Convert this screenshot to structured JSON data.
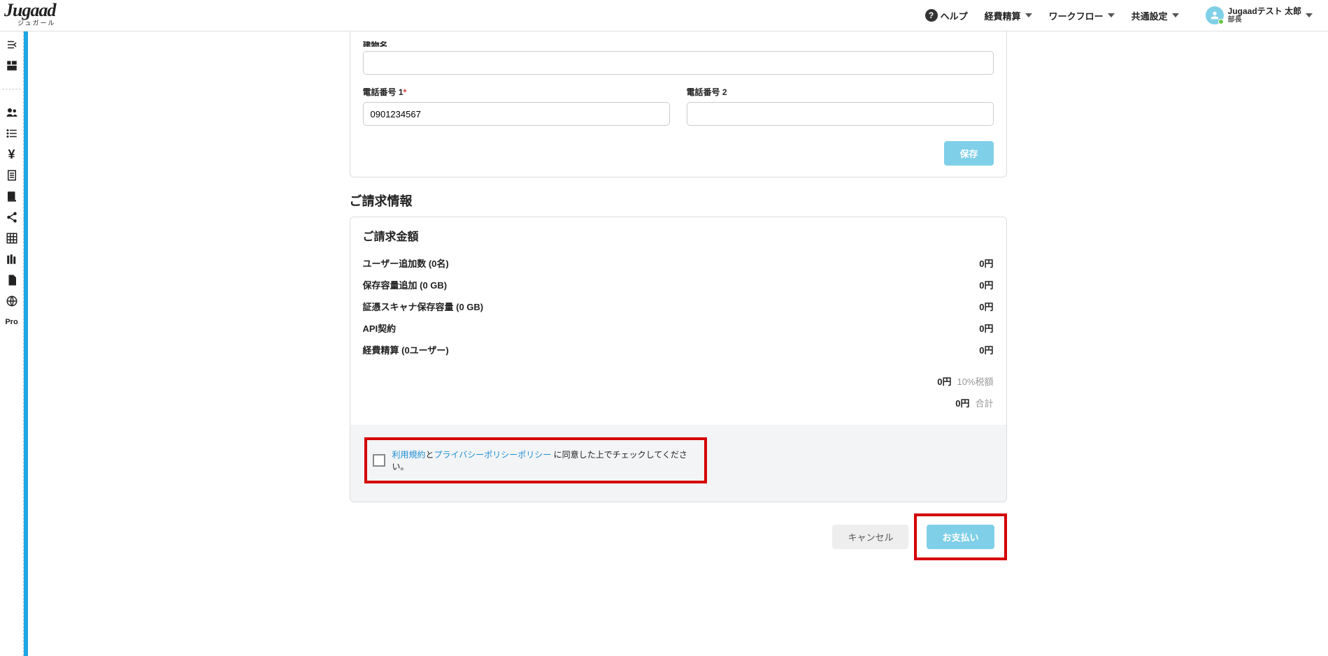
{
  "header": {
    "logo": "Jugaad",
    "logo_sub": "ジュガール",
    "help": "ヘルプ",
    "nav": {
      "expense": "経費精算",
      "workflow": "ワークフロー",
      "common": "共通設定"
    },
    "user": {
      "name": "Jugaadテスト 太郎",
      "role": "部長"
    }
  },
  "sidebar": {
    "pro": "Pro"
  },
  "form": {
    "building_label_cut": "建物名",
    "phone1_label": "電話番号 1",
    "phone1_value": "0901234567",
    "phone2_label": "電話番号 2",
    "phone2_value": "",
    "save": "保存"
  },
  "billing": {
    "section_title": "ご請求情報",
    "amount_title": "ご請求金額",
    "rows": [
      {
        "label": "ユーザー追加数 (0名)",
        "value": "0円"
      },
      {
        "label": "保存容量追加 (0 GB)",
        "value": "0円"
      },
      {
        "label": "証憑スキャナ保存容量 (0 GB)",
        "value": "0円"
      },
      {
        "label": "API契約",
        "value": "0円"
      },
      {
        "label": "経費精算 (0ユーザー)",
        "value": "0円"
      }
    ],
    "tax": {
      "value": "0円",
      "note": "10%税額"
    },
    "total": {
      "value": "0円",
      "note": "合計"
    }
  },
  "agree": {
    "terms": "利用規約",
    "and": "と",
    "privacy": "プライバシーポリシーポリシー",
    "rest": " に同意した上でチェックしてください。"
  },
  "actions": {
    "cancel": "キャンセル",
    "pay": "お支払い"
  }
}
